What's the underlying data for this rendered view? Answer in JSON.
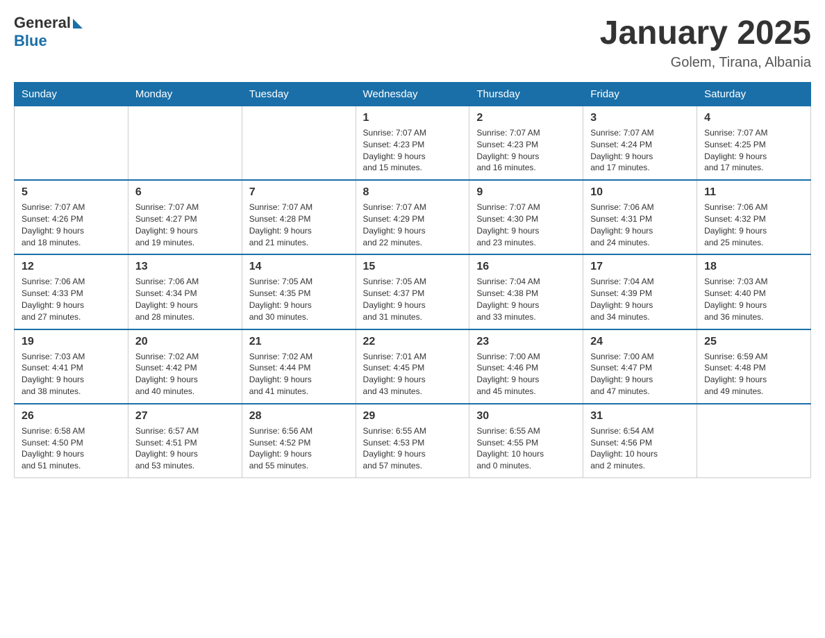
{
  "header": {
    "logo_general": "General",
    "logo_blue": "Blue",
    "title": "January 2025",
    "subtitle": "Golem, Tirana, Albania"
  },
  "weekdays": [
    "Sunday",
    "Monday",
    "Tuesday",
    "Wednesday",
    "Thursday",
    "Friday",
    "Saturday"
  ],
  "weeks": [
    [
      {
        "day": "",
        "info": ""
      },
      {
        "day": "",
        "info": ""
      },
      {
        "day": "",
        "info": ""
      },
      {
        "day": "1",
        "info": "Sunrise: 7:07 AM\nSunset: 4:23 PM\nDaylight: 9 hours\nand 15 minutes."
      },
      {
        "day": "2",
        "info": "Sunrise: 7:07 AM\nSunset: 4:23 PM\nDaylight: 9 hours\nand 16 minutes."
      },
      {
        "day": "3",
        "info": "Sunrise: 7:07 AM\nSunset: 4:24 PM\nDaylight: 9 hours\nand 17 minutes."
      },
      {
        "day": "4",
        "info": "Sunrise: 7:07 AM\nSunset: 4:25 PM\nDaylight: 9 hours\nand 17 minutes."
      }
    ],
    [
      {
        "day": "5",
        "info": "Sunrise: 7:07 AM\nSunset: 4:26 PM\nDaylight: 9 hours\nand 18 minutes."
      },
      {
        "day": "6",
        "info": "Sunrise: 7:07 AM\nSunset: 4:27 PM\nDaylight: 9 hours\nand 19 minutes."
      },
      {
        "day": "7",
        "info": "Sunrise: 7:07 AM\nSunset: 4:28 PM\nDaylight: 9 hours\nand 21 minutes."
      },
      {
        "day": "8",
        "info": "Sunrise: 7:07 AM\nSunset: 4:29 PM\nDaylight: 9 hours\nand 22 minutes."
      },
      {
        "day": "9",
        "info": "Sunrise: 7:07 AM\nSunset: 4:30 PM\nDaylight: 9 hours\nand 23 minutes."
      },
      {
        "day": "10",
        "info": "Sunrise: 7:06 AM\nSunset: 4:31 PM\nDaylight: 9 hours\nand 24 minutes."
      },
      {
        "day": "11",
        "info": "Sunrise: 7:06 AM\nSunset: 4:32 PM\nDaylight: 9 hours\nand 25 minutes."
      }
    ],
    [
      {
        "day": "12",
        "info": "Sunrise: 7:06 AM\nSunset: 4:33 PM\nDaylight: 9 hours\nand 27 minutes."
      },
      {
        "day": "13",
        "info": "Sunrise: 7:06 AM\nSunset: 4:34 PM\nDaylight: 9 hours\nand 28 minutes."
      },
      {
        "day": "14",
        "info": "Sunrise: 7:05 AM\nSunset: 4:35 PM\nDaylight: 9 hours\nand 30 minutes."
      },
      {
        "day": "15",
        "info": "Sunrise: 7:05 AM\nSunset: 4:37 PM\nDaylight: 9 hours\nand 31 minutes."
      },
      {
        "day": "16",
        "info": "Sunrise: 7:04 AM\nSunset: 4:38 PM\nDaylight: 9 hours\nand 33 minutes."
      },
      {
        "day": "17",
        "info": "Sunrise: 7:04 AM\nSunset: 4:39 PM\nDaylight: 9 hours\nand 34 minutes."
      },
      {
        "day": "18",
        "info": "Sunrise: 7:03 AM\nSunset: 4:40 PM\nDaylight: 9 hours\nand 36 minutes."
      }
    ],
    [
      {
        "day": "19",
        "info": "Sunrise: 7:03 AM\nSunset: 4:41 PM\nDaylight: 9 hours\nand 38 minutes."
      },
      {
        "day": "20",
        "info": "Sunrise: 7:02 AM\nSunset: 4:42 PM\nDaylight: 9 hours\nand 40 minutes."
      },
      {
        "day": "21",
        "info": "Sunrise: 7:02 AM\nSunset: 4:44 PM\nDaylight: 9 hours\nand 41 minutes."
      },
      {
        "day": "22",
        "info": "Sunrise: 7:01 AM\nSunset: 4:45 PM\nDaylight: 9 hours\nand 43 minutes."
      },
      {
        "day": "23",
        "info": "Sunrise: 7:00 AM\nSunset: 4:46 PM\nDaylight: 9 hours\nand 45 minutes."
      },
      {
        "day": "24",
        "info": "Sunrise: 7:00 AM\nSunset: 4:47 PM\nDaylight: 9 hours\nand 47 minutes."
      },
      {
        "day": "25",
        "info": "Sunrise: 6:59 AM\nSunset: 4:48 PM\nDaylight: 9 hours\nand 49 minutes."
      }
    ],
    [
      {
        "day": "26",
        "info": "Sunrise: 6:58 AM\nSunset: 4:50 PM\nDaylight: 9 hours\nand 51 minutes."
      },
      {
        "day": "27",
        "info": "Sunrise: 6:57 AM\nSunset: 4:51 PM\nDaylight: 9 hours\nand 53 minutes."
      },
      {
        "day": "28",
        "info": "Sunrise: 6:56 AM\nSunset: 4:52 PM\nDaylight: 9 hours\nand 55 minutes."
      },
      {
        "day": "29",
        "info": "Sunrise: 6:55 AM\nSunset: 4:53 PM\nDaylight: 9 hours\nand 57 minutes."
      },
      {
        "day": "30",
        "info": "Sunrise: 6:55 AM\nSunset: 4:55 PM\nDaylight: 10 hours\nand 0 minutes."
      },
      {
        "day": "31",
        "info": "Sunrise: 6:54 AM\nSunset: 4:56 PM\nDaylight: 10 hours\nand 2 minutes."
      },
      {
        "day": "",
        "info": ""
      }
    ]
  ]
}
